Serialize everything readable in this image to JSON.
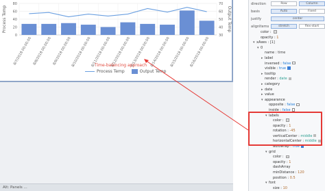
{
  "chart": {
    "y_left_title": "Process Temp",
    "y_right_title": "Output Temp",
    "subtitle": "Time-balancing approach",
    "legend": {
      "line_label": "Process Temp",
      "bar_label": "Output Temp"
    },
    "colors": {
      "line": "#6a9fe0",
      "bar": "#6a8fd4",
      "subtitle": "#e0483c"
    }
  },
  "chart_data": {
    "type": "bar",
    "categories": [
      "8/7/2018 00:00:00",
      "8/8/2018 00:00:00",
      "8/9/2018 00:00:00",
      "8/10/2018 00:00:00",
      "8/11/2018 00:00:00",
      "8/12/2018 00:00:00",
      "8/13/2018 00:00:00",
      "8/14/2018 00:00:00",
      "8/15/2018 00:00:00",
      "8/16/2018 00:00:00"
    ],
    "series": [
      {
        "name": "Output Temp",
        "kind": "bar",
        "axis": "right",
        "values": [
          44,
          44,
          45,
          43,
          40,
          46,
          44,
          43,
          61,
          48
        ]
      },
      {
        "name": "Process Temp",
        "kind": "line",
        "axis": "left",
        "values": [
          54,
          57,
          46,
          53,
          48,
          53,
          67,
          58,
          70,
          59
        ]
      }
    ],
    "y_left": {
      "label": "Process Temp",
      "ticks": [
        0,
        20,
        40,
        60,
        80
      ],
      "ylim": [
        0,
        80
      ]
    },
    "y_right": {
      "label": "Output Temp",
      "ticks": [
        30,
        40,
        50,
        60,
        70
      ],
      "ylim": [
        30,
        70
      ]
    },
    "grid": true,
    "legend_position": "bottom"
  },
  "props": {
    "top_options": [
      {
        "label": "direction",
        "buttons": [
          "Row",
          "Column"
        ],
        "active": 1
      },
      {
        "label": "basis",
        "buttons": [
          "Auto",
          "Fixed"
        ],
        "active": 0
      },
      {
        "label": "justify",
        "buttons": [
          "center"
        ],
        "active": 0
      },
      {
        "label": "alignItems",
        "buttons": [
          "stretch",
          "flex-start"
        ],
        "active": 0
      }
    ],
    "rows": [
      {
        "indent": 2,
        "caret": "",
        "key": "color",
        "type": "swatch"
      },
      {
        "indent": 2,
        "caret": "",
        "key": "opacity",
        "value": "1",
        "type": "num"
      },
      {
        "indent": 1,
        "caret": "▾",
        "key": "xAxes",
        "value": "[1]",
        "type": "text"
      },
      {
        "indent": 2,
        "caret": "▾",
        "key": "0",
        "value": "",
        "type": "text"
      },
      {
        "indent": 3,
        "caret": "",
        "key": "name",
        "value": "time",
        "type": "text"
      },
      {
        "indent": 3,
        "caret": "▸",
        "key": "label",
        "value": "",
        "type": "text"
      },
      {
        "indent": 3,
        "caret": "",
        "key": "inversed",
        "value": "false",
        "type": "bool"
      },
      {
        "indent": 3,
        "caret": "",
        "key": "visible",
        "value": "true",
        "type": "check"
      },
      {
        "indent": 3,
        "caret": "▸",
        "key": "tooltip",
        "value": "",
        "type": "text"
      },
      {
        "indent": 3,
        "caret": "",
        "key": "render",
        "value": "date",
        "type": "enum"
      },
      {
        "indent": 3,
        "caret": "▸",
        "key": "category",
        "value": "",
        "type": "text"
      },
      {
        "indent": 3,
        "caret": "▸",
        "key": "date",
        "value": "",
        "type": "text"
      },
      {
        "indent": 3,
        "caret": "▸",
        "key": "value",
        "value": "",
        "type": "text"
      },
      {
        "indent": 3,
        "caret": "▾",
        "key": "appearance",
        "value": "",
        "type": "text"
      },
      {
        "indent": 4,
        "caret": "",
        "key": "opposite",
        "value": "false",
        "type": "bool"
      },
      {
        "indent": 4,
        "caret": "",
        "key": "inside",
        "value": "false",
        "type": "bool"
      },
      {
        "indent": 4,
        "caret": "▾",
        "key": "labels",
        "value": "",
        "type": "text"
      },
      {
        "indent": 5,
        "caret": "",
        "key": "color",
        "value": "",
        "type": "swatch"
      },
      {
        "indent": 5,
        "caret": "",
        "key": "opacity",
        "value": "1",
        "type": "num"
      },
      {
        "indent": 5,
        "caret": "",
        "key": "rotation",
        "value": "-45",
        "type": "num"
      },
      {
        "indent": 5,
        "caret": "",
        "key": "verticalCenter",
        "value": "middle",
        "type": "enum"
      },
      {
        "indent": 5,
        "caret": "",
        "key": "horizontalCenter",
        "value": "middle",
        "type": "enum"
      },
      {
        "indent": 5,
        "caret": "",
        "key": "autowrap",
        "value": "true",
        "type": "check"
      },
      {
        "indent": 4,
        "caret": "▾",
        "key": "grid",
        "value": "",
        "type": "text"
      },
      {
        "indent": 5,
        "caret": "",
        "key": "color",
        "value": "",
        "type": "swatch"
      },
      {
        "indent": 5,
        "caret": "",
        "key": "opacity",
        "value": "1",
        "type": "num"
      },
      {
        "indent": 5,
        "caret": "",
        "key": "dashArray",
        "value": "",
        "type": "text"
      },
      {
        "indent": 5,
        "caret": "",
        "key": "minDistance",
        "value": "120",
        "type": "num"
      },
      {
        "indent": 5,
        "caret": "",
        "key": "position",
        "value": "0.5",
        "type": "num"
      },
      {
        "indent": 4,
        "caret": "▾",
        "key": "font",
        "value": "",
        "type": "text"
      },
      {
        "indent": 5,
        "caret": "",
        "key": "size",
        "value": "10",
        "type": "num"
      },
      {
        "indent": 5,
        "caret": "",
        "key": "weight",
        "value": "500",
        "type": "num"
      }
    ]
  },
  "status_bar": {
    "text": "Alt: Panels ..."
  }
}
